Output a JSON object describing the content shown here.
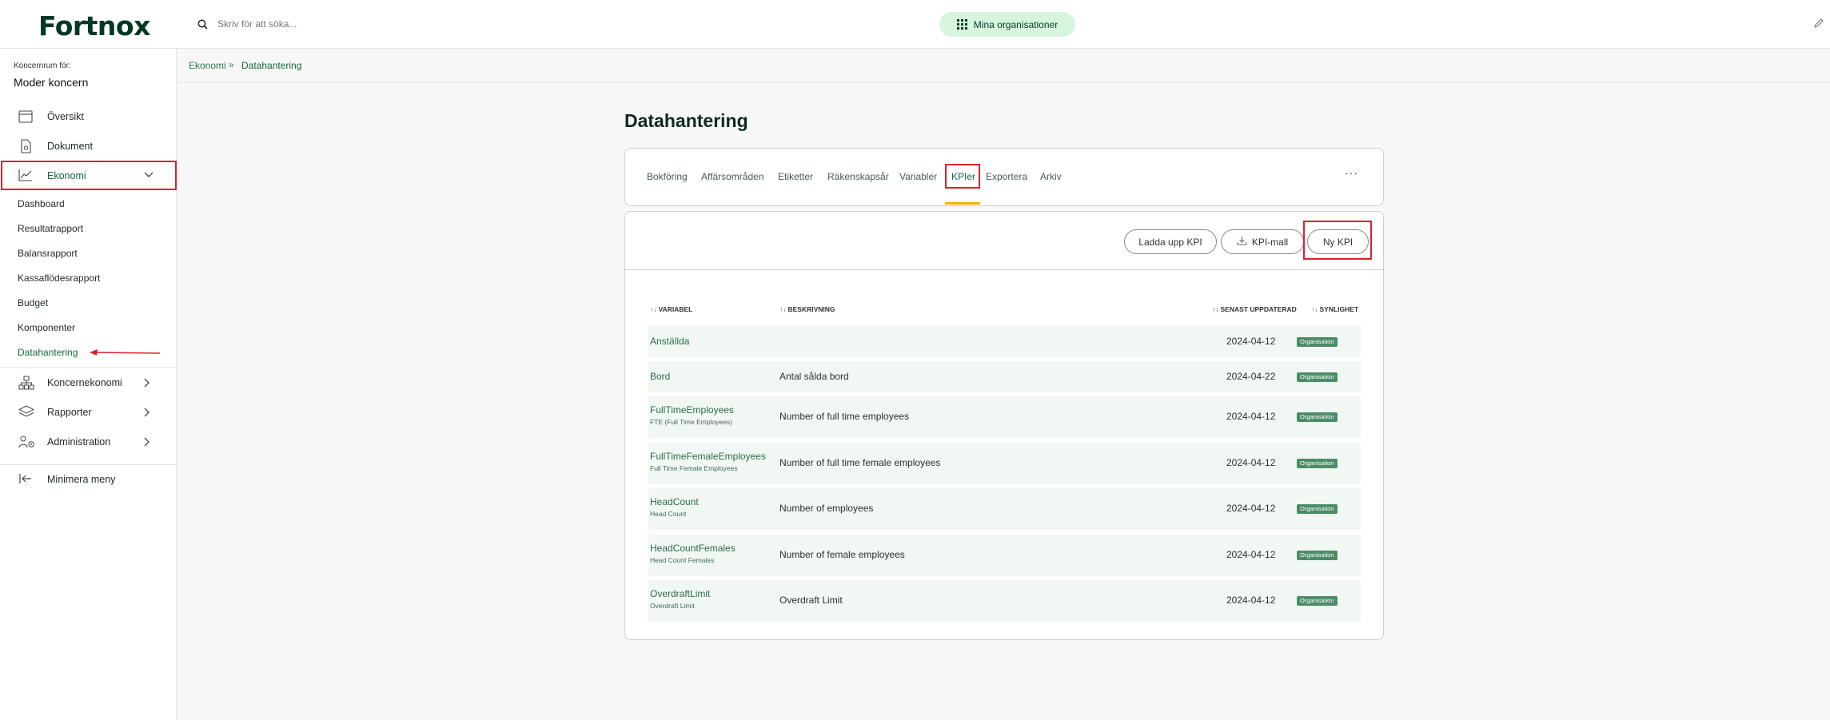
{
  "header": {
    "logo": "Fortnox",
    "search_placeholder": "Skriv för att söka...",
    "org_button": "Mina organisationer"
  },
  "sidebar": {
    "subtitle": "Koncernrum för:",
    "title": "Moder koncern",
    "items": [
      {
        "label": "Översikt",
        "icon": "calendar-icon"
      },
      {
        "label": "Dokument",
        "icon": "document-icon"
      },
      {
        "label": "Ekonomi",
        "icon": "chart-line-icon"
      }
    ],
    "ekonomi_sub": [
      "Dashboard",
      "Resultatrapport",
      "Balansrapport",
      "Kassaflödesrapport",
      "Budget",
      "Komponenter",
      "Datahantering"
    ],
    "lower_items": [
      {
        "label": "Koncernekonomi",
        "icon": "org-tree-icon"
      },
      {
        "label": "Rapporter",
        "icon": "layers-icon"
      },
      {
        "label": "Administration",
        "icon": "people-gear-icon"
      }
    ],
    "minimize": "Minimera meny"
  },
  "breadcrumb": {
    "parent": "Ekonomi",
    "separator": "»",
    "current": "Datahantering"
  },
  "page": {
    "title": "Datahantering",
    "tabs": [
      "Bokföring",
      "Affärsområden",
      "Etiketter",
      "Räkenskapsår",
      "Variabler",
      "KPIer",
      "Exportera",
      "Arkiv"
    ],
    "active_tab": "KPIer",
    "more": "···"
  },
  "actions": {
    "upload": "Ladda upp KPI",
    "template": "KPI-mall",
    "new": "Ny KPI"
  },
  "table": {
    "sort_glyph": "↑↓",
    "headers": {
      "variable": "VARIABEL",
      "description": "BESKRIVNING",
      "updated": "SENAST UPPDATERAD",
      "visibility": "SYNLIGHET"
    },
    "rows": [
      {
        "variable": "Anställda",
        "sub": "",
        "description": "",
        "updated": "2024-04-12",
        "visibility": "Organisation"
      },
      {
        "variable": "Bord",
        "sub": "",
        "description": "Antal sålda bord",
        "updated": "2024-04-22",
        "visibility": "Organisation"
      },
      {
        "variable": "FullTimeEmployees",
        "sub": "FTE (Full Time Employees)",
        "description": "Number of full time employees",
        "updated": "2024-04-12",
        "visibility": "Organisation"
      },
      {
        "variable": "FullTimeFemaleEmployees",
        "sub": "Full Time Female Employees",
        "description": "Number of full time female employees",
        "updated": "2024-04-12",
        "visibility": "Organisation"
      },
      {
        "variable": "HeadCount",
        "sub": "Head Count",
        "description": "Number of employees",
        "updated": "2024-04-12",
        "visibility": "Organisation"
      },
      {
        "variable": "HeadCountFemales",
        "sub": "Head Count Females",
        "description": "Number of female employees",
        "updated": "2024-04-12",
        "visibility": "Organisation"
      },
      {
        "variable": "OverdraftLimit",
        "sub": "Overdraft Limit",
        "description": "Overdraft Limit",
        "updated": "2024-04-12",
        "visibility": "Organisation"
      }
    ]
  },
  "colors": {
    "brand": "#003824",
    "accent_green": "#d6f5dc",
    "tab_underline": "#f0b400",
    "annotation_red": "#d9232c",
    "badge": "#4c8c68"
  }
}
